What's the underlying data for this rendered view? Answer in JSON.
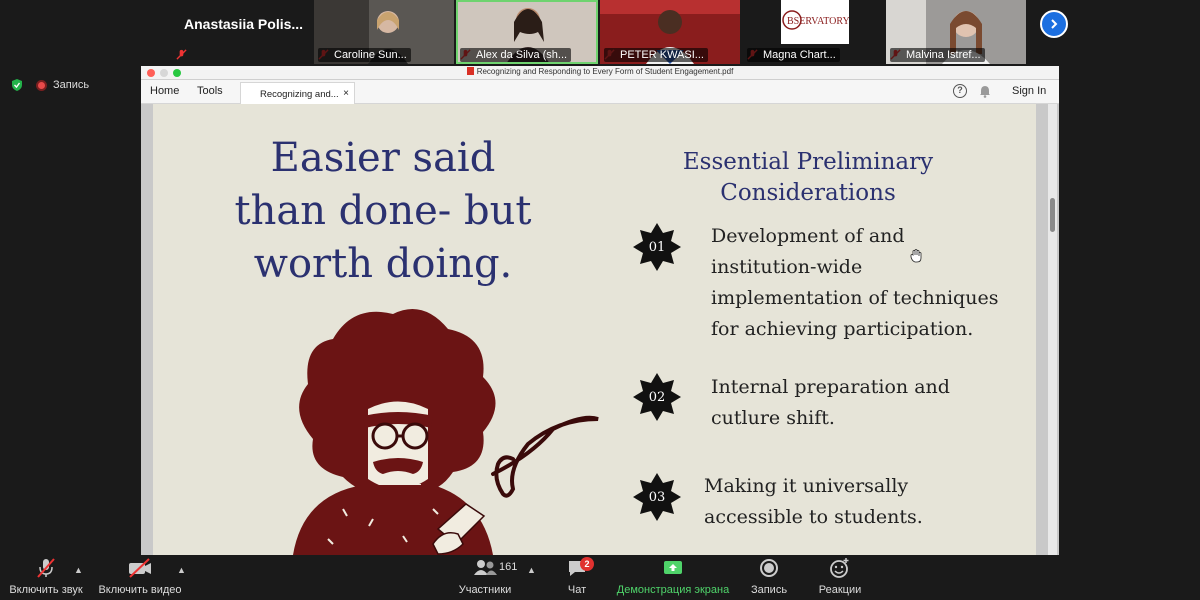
{
  "participants": [
    {
      "name": "Anastasiia  Polis..."
    },
    {
      "name": "Caroline Sun..."
    },
    {
      "name": "Alex da Silva (sh..."
    },
    {
      "name": "PETER KWASI..."
    },
    {
      "name": "Magna Chart..."
    },
    {
      "name": "Malvina Istref..."
    }
  ],
  "status": {
    "recording_label": "Запись"
  },
  "pdf_window": {
    "title": "Recognizing and Responding to Every Form of Student Engagement.pdf",
    "menu_home": "Home",
    "menu_tools": "Tools",
    "tab_label": "Recognizing and...",
    "tab_close": "×",
    "help_symbol": "?",
    "sign_in": "Sign In"
  },
  "slide": {
    "headline_lines": [
      "Easier said",
      "than done- but",
      "worth doing."
    ],
    "subhead_lines": [
      "Essential Preliminary",
      "Considerations"
    ],
    "items": [
      {
        "num": "01",
        "lines": [
          "Development of and",
          "institution-wide",
          "implementation of techniques",
          "for achieving participation."
        ]
      },
      {
        "num": "02",
        "lines": [
          "Internal preparation and",
          "cutlure shift."
        ]
      },
      {
        "num": "03",
        "lines": [
          "Making it universally",
          "accessible to students."
        ]
      }
    ],
    "logo_text": "BSERVATORY"
  },
  "controls": {
    "mic_label": "Включить звук",
    "video_label": "Включить видео",
    "participants_label": "Участники",
    "participants_count": "161",
    "chat_label": "Чат",
    "chat_badge": "2",
    "share_label": "Демонстрация экрана",
    "record_label": "Запись",
    "reactions_label": "Реакции"
  },
  "colors": {
    "slide_bg": "#e6e4d8",
    "slide_title": "#2b3170",
    "share_green": "#4fd36a",
    "brand_blue": "#1c6fe0"
  }
}
